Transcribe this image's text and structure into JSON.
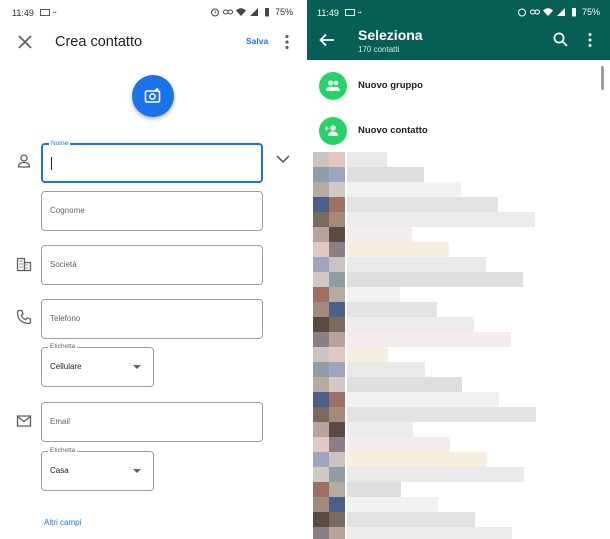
{
  "left": {
    "status": {
      "time": "11:49",
      "battery": "75%"
    },
    "toolbar": {
      "title": "Crea contatto",
      "save_label": "Salva"
    },
    "fields": {
      "nome_label": "Nome",
      "cognome_placeholder": "Cognome",
      "societa_placeholder": "Società",
      "telefono_placeholder": "Telefono",
      "telefono_etichetta_label": "Etichetta",
      "telefono_etichetta_value": "Cellulare",
      "email_placeholder": "Email",
      "email_etichetta_label": "Etichetta",
      "email_etichetta_value": "Casa"
    },
    "more_fields_label": "Altri campi",
    "icons": [
      "close-icon",
      "more-vert-icon",
      "add-photo-icon",
      "person-icon",
      "business-icon",
      "phone-icon",
      "email-icon",
      "chevron-down-icon"
    ],
    "colors": {
      "accent": "#1a73e8"
    }
  },
  "right": {
    "status": {
      "time": "11:49",
      "battery": "75%"
    },
    "header": {
      "title": "Seleziona",
      "subtitle": "170 contatti"
    },
    "actions": {
      "new_group": "Nuovo gruppo",
      "new_contact": "Nuovo contatto"
    },
    "icons": [
      "back-arrow-icon",
      "search-icon",
      "more-vert-icon",
      "group-add-icon",
      "person-add-icon"
    ],
    "colors": {
      "header": "#075e54",
      "accent": "#25d366"
    }
  }
}
